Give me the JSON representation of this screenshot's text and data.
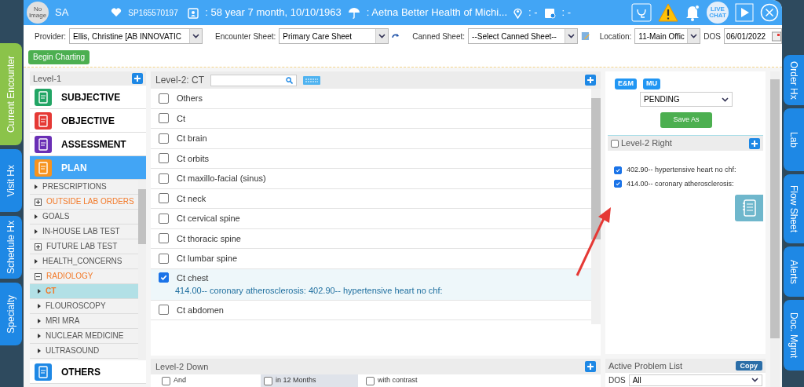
{
  "header": {
    "avatar": "No Image",
    "patient_name": "SA",
    "patient_id": "SP165570197",
    "age_dob": ": 58 year 7 month, 10/10/1963",
    "insurance": ": Aetna Better Health of Michi...",
    "location": ": -",
    "appointment": ": -",
    "live_chat": "LIVE CHAT"
  },
  "left_tabs": [
    {
      "label": "Current Encounter",
      "selected": true
    },
    {
      "label": "Visit Hx",
      "selected": false
    },
    {
      "label": "Schedule Hx",
      "selected": false
    },
    {
      "label": "Specialty",
      "selected": false
    }
  ],
  "right_tabs": [
    "Order Hx",
    "Lab",
    "Flow Sheet",
    "Alerts",
    "Doc. Mgmt"
  ],
  "toolbar": {
    "provider_label": "Provider:",
    "provider": "Ellis, Christine [AB INNOVATIC",
    "encounter_label": "Encounter Sheet:",
    "encounter": "Primary Care Sheet",
    "canned_label": "Canned Sheet:",
    "canned": "--Select Canned Sheet--",
    "location_label": "Location:",
    "location": "11-Main Offic",
    "dos_label": "DOS",
    "dos": "06/01/2022"
  },
  "begin_charting": "Begin Charting",
  "level1": {
    "title": "Level-1",
    "categories": [
      {
        "label": "SUBJECTIVE",
        "kind": "subjective",
        "selected": false
      },
      {
        "label": "OBJECTIVE",
        "kind": "objective",
        "selected": false
      },
      {
        "label": "ASSESSMENT",
        "kind": "assessment",
        "selected": false
      },
      {
        "label": "PLAN",
        "kind": "plan",
        "selected": true
      }
    ],
    "items": [
      {
        "label": "PRESCRIPTIONS",
        "kind": "leaf",
        "has_entries": false,
        "selected": false
      },
      {
        "label": "OUTSIDE LAB ORDERS",
        "kind": "group",
        "expanded": false,
        "has_entries": true,
        "selected": false
      },
      {
        "label": "GOALS",
        "kind": "leaf",
        "has_entries": false,
        "selected": false
      },
      {
        "label": "IN-HOUSE LAB TEST",
        "kind": "leaf",
        "has_entries": false,
        "selected": false
      },
      {
        "label": "FUTURE LAB TEST",
        "kind": "group",
        "expanded": false,
        "has_entries": false,
        "selected": false
      },
      {
        "label": "HEALTH_CONCERNS",
        "kind": "leaf",
        "has_entries": false,
        "selected": false
      },
      {
        "label": "RADIOLOGY",
        "kind": "group",
        "expanded": true,
        "has_entries": true,
        "selected": false,
        "children": [
          {
            "label": "CT",
            "kind": "leaf",
            "has_entries": true,
            "selected": true
          },
          {
            "label": "FLOUROSCOPY",
            "kind": "leaf",
            "has_entries": false,
            "selected": false
          },
          {
            "label": "MRI MRA",
            "kind": "leaf",
            "has_entries": false,
            "selected": false
          },
          {
            "label": "NUCLEAR MEDICINE",
            "kind": "leaf",
            "has_entries": false,
            "selected": false
          },
          {
            "label": "ULTRASOUND",
            "kind": "leaf",
            "has_entries": false,
            "selected": false
          }
        ]
      }
    ],
    "bottom_category": {
      "label": "OTHERS",
      "kind": "others",
      "selected": false
    }
  },
  "level2": {
    "title": "Level-2: CT",
    "items": [
      {
        "label": "Others",
        "checked": false
      },
      {
        "label": "Ct",
        "checked": false
      },
      {
        "label": "Ct brain",
        "checked": false
      },
      {
        "label": "Ct orbits",
        "checked": false
      },
      {
        "label": "Ct maxillo-facial (sinus)",
        "checked": false
      },
      {
        "label": "Ct neck",
        "checked": false
      },
      {
        "label": "Ct cervical spine",
        "checked": false
      },
      {
        "label": "Ct thoracic spine",
        "checked": false
      },
      {
        "label": "Ct lumbar spine",
        "checked": false
      },
      {
        "label": "Ct chest",
        "checked": true,
        "detail": "414.00-- coronary atherosclerosis: 402.90-- hypertensive heart no chf:"
      },
      {
        "label": "Ct abdomen",
        "checked": false
      }
    ]
  },
  "level2_down": {
    "title": "Level-2 Down",
    "options": [
      {
        "label": "And",
        "checked": false,
        "selected": false
      },
      {
        "label": "in 12 Months",
        "checked": false,
        "selected": true
      },
      {
        "label": "with contrast",
        "checked": false,
        "selected": false
      }
    ]
  },
  "right_panel": {
    "buttons": [
      "E&M",
      "MU"
    ],
    "status": "PENDING",
    "save": "Save As",
    "level2_right": {
      "title": "Level-2 Right",
      "checked": false,
      "items": [
        {
          "label": "402.90-- hypertensive heart no chf:",
          "checked": true
        },
        {
          "label": "414.00-- coronary atherosclerosis:",
          "checked": true
        }
      ]
    },
    "problem_list": {
      "title": "Active Problem List",
      "copy": "Copy",
      "dos_label": "DOS",
      "dos": "All"
    }
  }
}
